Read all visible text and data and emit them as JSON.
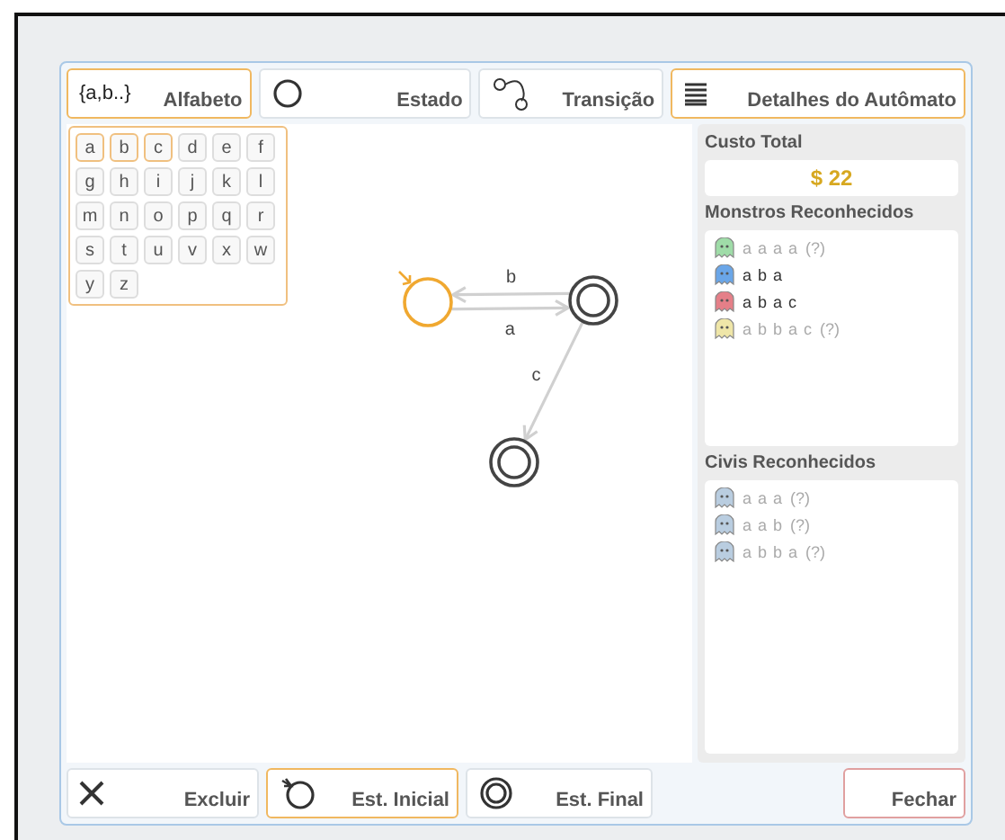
{
  "toolbar": [
    {
      "kind": "alphabet",
      "glyph": "{a,b..}",
      "label": "Alfabeto",
      "selected": true
    },
    {
      "kind": "state",
      "label": "Estado",
      "selected": false
    },
    {
      "kind": "transition",
      "label": "Transição",
      "selected": false
    },
    {
      "kind": "details",
      "label": "Detalhes do Autômato",
      "selected": true
    }
  ],
  "alphabet": [
    {
      "letter": "a",
      "selected": true
    },
    {
      "letter": "b",
      "selected": true
    },
    {
      "letter": "c",
      "selected": true
    },
    {
      "letter": "d",
      "selected": false
    },
    {
      "letter": "e",
      "selected": false
    },
    {
      "letter": "f",
      "selected": false
    },
    {
      "letter": "g",
      "selected": false
    },
    {
      "letter": "h",
      "selected": false
    },
    {
      "letter": "i",
      "selected": false
    },
    {
      "letter": "j",
      "selected": false
    },
    {
      "letter": "k",
      "selected": false
    },
    {
      "letter": "l",
      "selected": false
    },
    {
      "letter": "m",
      "selected": false
    },
    {
      "letter": "n",
      "selected": false
    },
    {
      "letter": "o",
      "selected": false
    },
    {
      "letter": "p",
      "selected": false
    },
    {
      "letter": "q",
      "selected": false
    },
    {
      "letter": "r",
      "selected": false
    },
    {
      "letter": "s",
      "selected": false
    },
    {
      "letter": "t",
      "selected": false
    },
    {
      "letter": "u",
      "selected": false
    },
    {
      "letter": "v",
      "selected": false
    },
    {
      "letter": "x",
      "selected": false
    },
    {
      "letter": "w",
      "selected": false
    },
    {
      "letter": "y",
      "selected": false
    },
    {
      "letter": "z",
      "selected": false
    }
  ],
  "automaton": {
    "states": [
      {
        "initial": true,
        "final": false,
        "selected": true
      },
      {
        "initial": false,
        "final": true,
        "selected": false
      },
      {
        "initial": false,
        "final": true,
        "selected": false
      }
    ],
    "transitions": [
      {
        "label": "b"
      },
      {
        "label": "a"
      },
      {
        "label": "c"
      }
    ]
  },
  "details": {
    "cost_label": "Custo Total",
    "cost": "$ 22",
    "monsters_title": "Monstros Reconhecidos",
    "monsters": [
      {
        "word": "a a a a",
        "note": "(?)",
        "recognized": false,
        "color": "#9fdca8"
      },
      {
        "word": "a b a",
        "recognized": true,
        "color": "#6aa6e8"
      },
      {
        "word": "a b a c",
        "recognized": true,
        "color": "#e57f88"
      },
      {
        "word": "a b b a c",
        "note": "(?)",
        "recognized": false,
        "color": "#efe6a8"
      }
    ],
    "civilians_title": "Civis Reconhecidos",
    "civilians": [
      {
        "word": "a a a",
        "note": "(?)",
        "recognized": false,
        "color": "#b9cde0"
      },
      {
        "word": "a a b",
        "note": "(?)",
        "recognized": false,
        "color": "#b9cde0"
      },
      {
        "word": "a b b a",
        "note": "(?)",
        "recognized": false,
        "color": "#b9cde0"
      }
    ]
  },
  "bottom": [
    {
      "kind": "delete",
      "label": "Excluir",
      "selected": false
    },
    {
      "kind": "initial",
      "label": "Est. Inicial",
      "selected": true
    },
    {
      "kind": "final",
      "label": "Est. Final",
      "selected": false
    },
    {
      "kind": "close",
      "label": "Fechar"
    }
  ]
}
